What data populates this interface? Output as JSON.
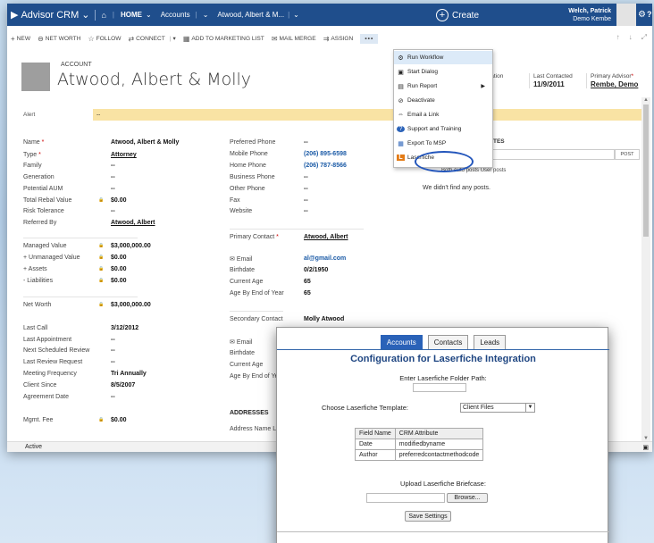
{
  "topbar": {
    "app": "Advisor CRM",
    "home": "HOME",
    "section": "Accounts",
    "record": "Atwood, Albert & M...",
    "create": "Create",
    "user_name": "Welch, Patrick",
    "user_org": "Demo Kembe"
  },
  "commands": [
    {
      "icon": "+",
      "label": "NEW"
    },
    {
      "icon": "⊖",
      "label": "NET WORTH"
    },
    {
      "icon": "☆",
      "label": "FOLLOW"
    },
    {
      "icon": "⇄",
      "label": "CONNECT"
    },
    {
      "icon": "▦",
      "label": "ADD TO MARKETING LIST"
    },
    {
      "icon": "✉",
      "label": "MAIL MERGE"
    },
    {
      "icon": "⇉",
      "label": "ASSIGN"
    },
    {
      "icon": "",
      "label": "•••"
    }
  ],
  "header": {
    "entity": "ACCOUNT",
    "name": "Atwood, Albert & Molly",
    "location_label": "cation",
    "last_contacted_label": "Last Contacted",
    "last_contacted": "11/9/2011",
    "primary_advisor_label": "Primary Advisor",
    "primary_advisor": "Rembe, Demo"
  },
  "alert": {
    "label": "Alert",
    "value": "--"
  },
  "left_fields": [
    {
      "label": "Name",
      "req": true,
      "value": "Atwood, Albert & Molly",
      "style": ""
    },
    {
      "label": "Type",
      "req": true,
      "value": "Attorney",
      "style": "link"
    },
    {
      "label": "Family",
      "value": "--"
    },
    {
      "label": "Generation",
      "value": "--"
    },
    {
      "label": "Potential AUM",
      "value": "--"
    },
    {
      "label": "Total Rebal Value",
      "value": "$0.00",
      "lock": true
    },
    {
      "label": "Risk Tolerance",
      "value": "--"
    },
    {
      "label": "Referred By",
      "value": "Atwood, Albert",
      "style": "link"
    },
    {
      "label": "Managed Value",
      "value": "$3,000,000.00",
      "lock": true
    },
    {
      "label": "+ Unmanaged Value",
      "value": "$0.00",
      "lock": true
    },
    {
      "label": "+ Assets",
      "value": "$0.00",
      "lock": true
    },
    {
      "label": "- Liabilities",
      "value": "$0.00",
      "lock": true
    },
    {
      "label": "Net Worth",
      "value": "$3,000,000.00",
      "lock": true
    },
    {
      "label": "Last Call",
      "value": "3/12/2012"
    },
    {
      "label": "Last Appointment",
      "value": "--"
    },
    {
      "label": "Next Scheduled Review",
      "value": "--"
    },
    {
      "label": "Last Review Request",
      "value": "--"
    },
    {
      "label": "Meeting Frequency",
      "value": "Tri Annually"
    },
    {
      "label": "Client Since",
      "value": "8/5/2007"
    },
    {
      "label": "Agreement Date",
      "value": "--"
    },
    {
      "label": "Mgmt. Fee",
      "value": "$0.00",
      "lock": true
    }
  ],
  "mid_fields": [
    {
      "label": "Preferred Phone",
      "value": "--"
    },
    {
      "label": "Mobile Phone",
      "value": "(206) 895-6598",
      "style": "blue"
    },
    {
      "label": "Home Phone",
      "value": "(206) 787-8566",
      "style": "blue"
    },
    {
      "label": "Business Phone",
      "value": "--"
    },
    {
      "label": "Other Phone",
      "value": "--"
    },
    {
      "label": "Fax",
      "value": "--"
    },
    {
      "label": "Website",
      "value": "--"
    },
    {
      "label": "Primary Contact",
      "req": true,
      "value": "Atwood, Albert",
      "style": "link"
    },
    {
      "label": "Email",
      "icon": "✉",
      "value": "al@gmail.com",
      "style": "blue"
    },
    {
      "label": "Birthdate",
      "value": "0/2/1950"
    },
    {
      "label": "Current Age",
      "value": "65"
    },
    {
      "label": "Age By End of Year",
      "value": "65"
    },
    {
      "label": "Secondary Contact",
      "value": "Molly Atwood"
    },
    {
      "label": "Email",
      "icon": "✉",
      "value": ""
    },
    {
      "label": "Birthdate",
      "value": ""
    },
    {
      "label": "Current Age",
      "value": ""
    },
    {
      "label": "Age By End of Ye",
      "value": ""
    },
    {
      "label": "ADDRESSES",
      "value": "",
      "bold": true
    },
    {
      "label": "Address Name Li",
      "value": ""
    }
  ],
  "notes": {
    "heading": "TES",
    "post": "POST",
    "filter": "Both    Auto posts    User posts",
    "empty": "We didn't find any posts."
  },
  "menu": [
    {
      "icon": "⚙",
      "label": "Run Workflow"
    },
    {
      "icon": "▣",
      "label": "Start Dialog"
    },
    {
      "icon": "▤",
      "label": "Run Report",
      "arrow": true
    },
    {
      "icon": "⊘",
      "label": "Deactivate"
    },
    {
      "icon": "⇔",
      "label": "Email a Link"
    },
    {
      "icon": "?",
      "label": "Support and Training"
    },
    {
      "icon": "▦",
      "label": "Export To MSP"
    },
    {
      "icon": "L",
      "label": "Laserfiche"
    }
  ],
  "status": "Active",
  "dialog": {
    "tabs": [
      "Accounts",
      "Contacts",
      "Leads"
    ],
    "active_tab": "Accounts",
    "title": "Configuration for Laserfiche Integration",
    "folder_label": "Enter Laserfiche Folder Path:",
    "template_label": "Choose Laserfiche Template:",
    "template_value": "Client Files",
    "table_head": [
      "Field Name",
      "CRM Attribute"
    ],
    "table_rows": [
      [
        "Date",
        "modifiedbyname"
      ],
      [
        "Author",
        "preferredcontactmethodcode"
      ]
    ],
    "briefcase_label": "Upload Laserfiche Briefcase:",
    "browse": "Browse...",
    "save": "Save Settings"
  }
}
